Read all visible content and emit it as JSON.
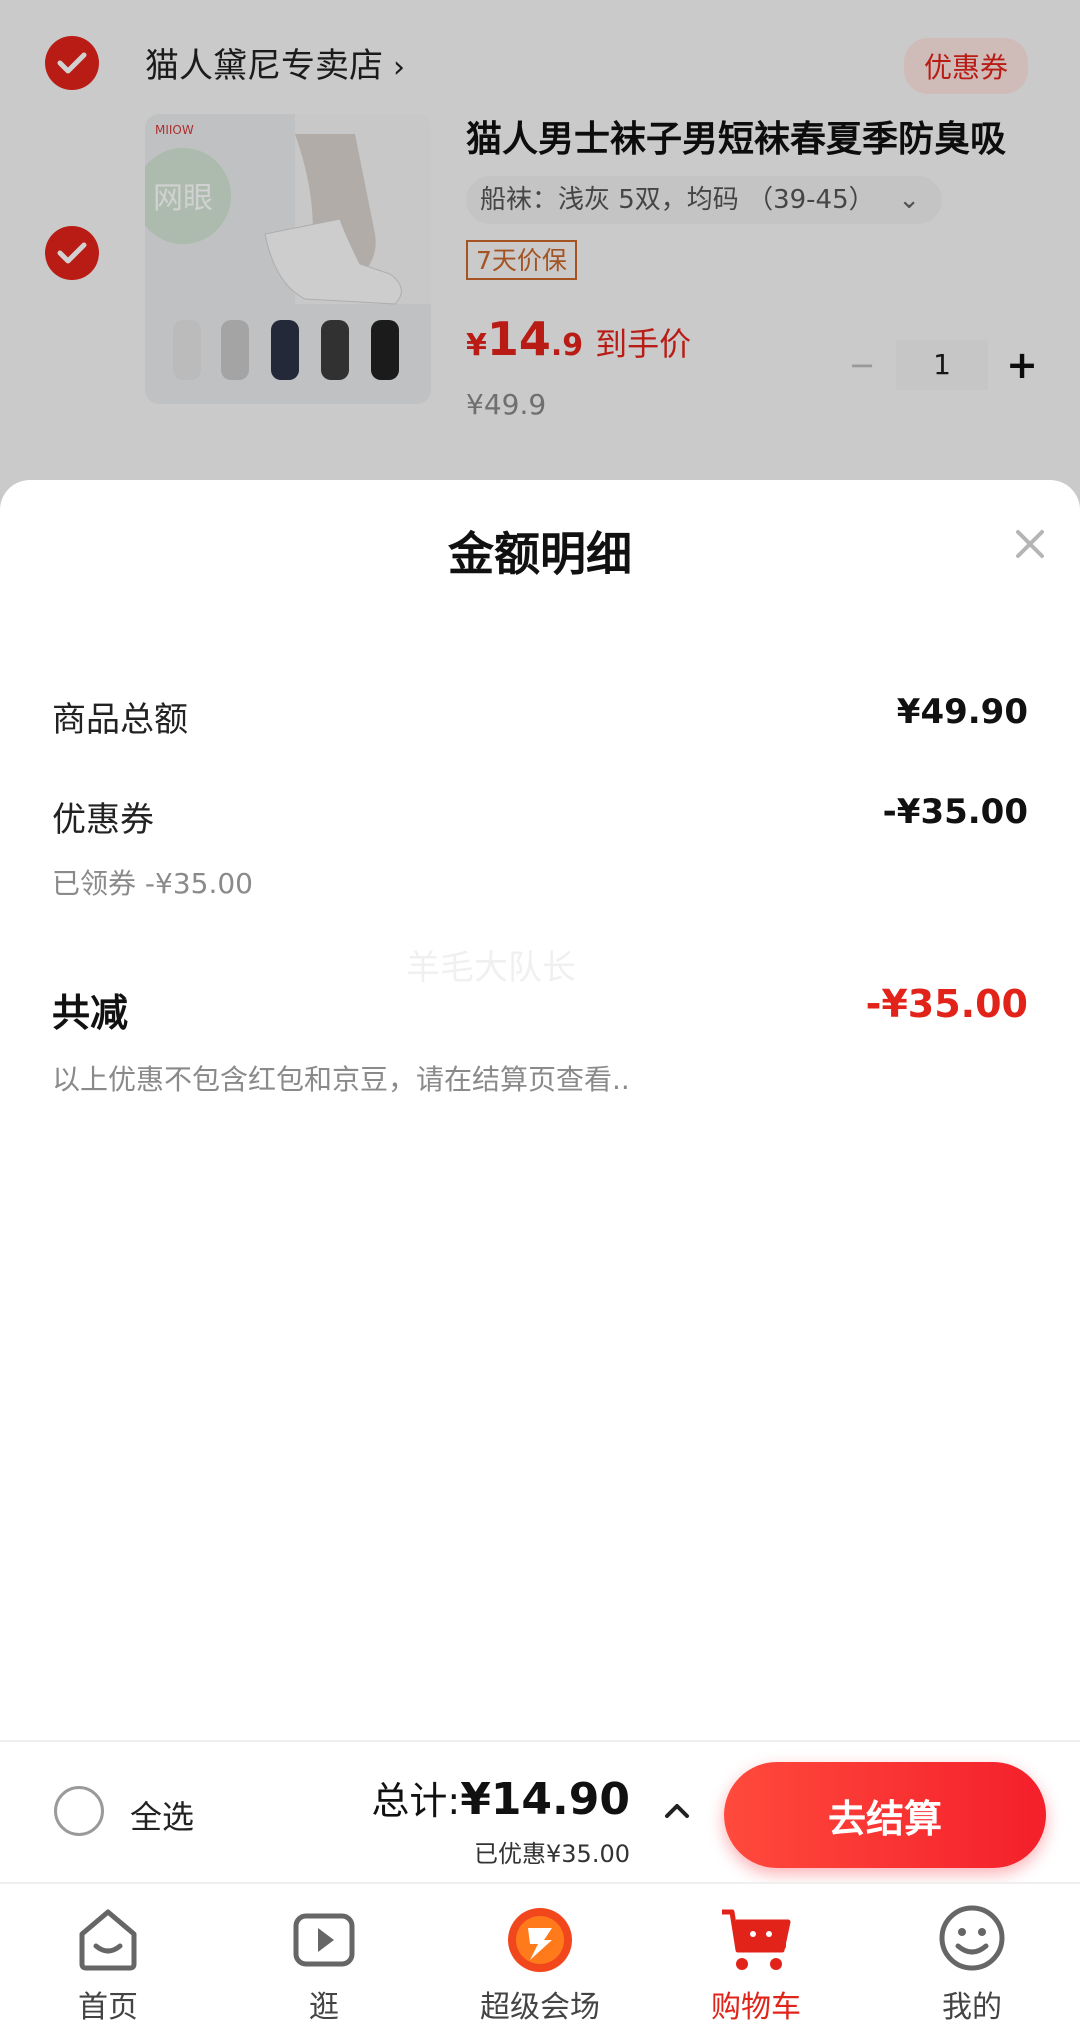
{
  "cart": {
    "shop_name": "猫人黛尼专卖店",
    "shop_arrow": "›",
    "coupon_tag": "优惠券",
    "product": {
      "brand_logo": "MIIOW",
      "image_badge": "网眼",
      "title": "猫人男士袜子男短袜春夏季防臭吸",
      "spec": "船袜：浅灰 5双，均码 （39-45）",
      "spec_chevron": "⌄",
      "guarantee": "7天价保",
      "price_symbol": "¥",
      "price_int": "14",
      "price_dec": ".9",
      "price_label": "到手价",
      "original_price": "¥49.9",
      "quantity": "1",
      "minus": "−",
      "plus": "+"
    }
  },
  "sheet": {
    "title": "金额明细",
    "goods_total_label": "商品总额",
    "goods_total_value": "¥49.90",
    "coupon_label": "优惠券",
    "coupon_value": "-¥35.00",
    "coupon_sub": "已领券 -¥35.00",
    "total_reduce_label": "共减",
    "total_reduce_value": "-¥35.00",
    "note": "以上优惠不包含红包和京豆，请在结算页查看..",
    "watermark": "羊毛大队长"
  },
  "checkout": {
    "select_all": "全选",
    "total_label": "总计:",
    "total_value": "¥14.90",
    "saved": "已优惠¥35.00",
    "button": "去结算"
  },
  "tabs": [
    {
      "label": "首页",
      "icon": "home-icon"
    },
    {
      "label": "逛",
      "icon": "video-icon"
    },
    {
      "label": "超级会场",
      "icon": "super-venue-icon"
    },
    {
      "label": "购物车",
      "icon": "cart-icon",
      "active": true
    },
    {
      "label": "我的",
      "icon": "smiley-icon"
    }
  ],
  "colors": {
    "accent": "#e2231a",
    "checkout_button": "#f41f2b"
  }
}
